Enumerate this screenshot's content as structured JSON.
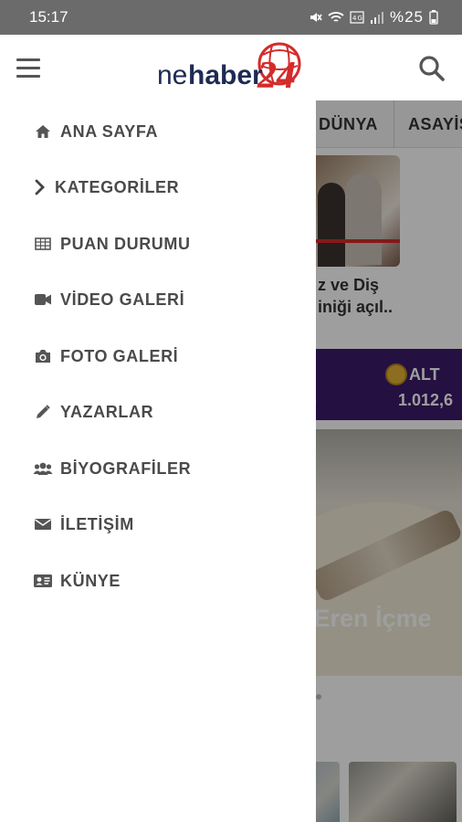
{
  "status_bar": {
    "time": "15:17",
    "icons": [
      "mute-icon",
      "wifi-icon",
      "volte-icon",
      "signal-icon"
    ],
    "battery": "%25"
  },
  "app_bar": {
    "logo_text_ne": "ne",
    "logo_text_haber": "haber",
    "logo_text_24": "24",
    "brand_dark": "#1f2a55",
    "brand_red": "#d42b2b"
  },
  "drawer": {
    "items": [
      {
        "label": "ANA SAYFA",
        "icon": "home-icon"
      },
      {
        "label": "KATEGORİLER",
        "icon": "chevron-right-icon"
      },
      {
        "label": "PUAN DURUMU",
        "icon": "table-icon"
      },
      {
        "label": "VİDEO GALERİ",
        "icon": "video-camera-icon"
      },
      {
        "label": "FOTO GALERİ",
        "icon": "camera-icon"
      },
      {
        "label": "YAZARLAR",
        "icon": "pencil-icon"
      },
      {
        "label": "BİYOGRAFİLER",
        "icon": "users-icon"
      },
      {
        "label": "İLETİŞİM",
        "icon": "envelope-icon"
      },
      {
        "label": "KÜNYE",
        "icon": "id-card-icon"
      }
    ]
  },
  "background": {
    "tabs": [
      "DÜNYA",
      "ASAYİŞ"
    ],
    "news_caption_line1": "z ve Diş",
    "news_caption_line2": "iniği açıl..",
    "finance_label": "ALT",
    "finance_value": "1.012,6",
    "finance_teal": "5",
    "slider_caption": "rı Eren İçme"
  }
}
